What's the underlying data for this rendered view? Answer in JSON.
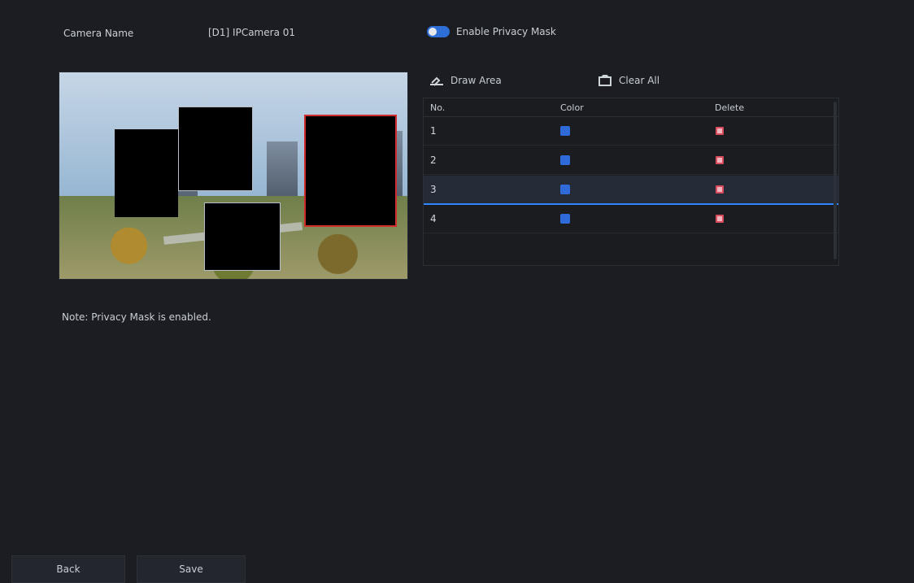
{
  "header": {
    "left_label": "Camera Name",
    "camera_value": "[D1] IPCamera 01",
    "mask_toggle_label": "Enable Privacy Mask"
  },
  "toolbar": {
    "draw_label": "Draw Area",
    "clear_label": "Clear All"
  },
  "table": {
    "headers": [
      "No.",
      "Color",
      "Delete"
    ],
    "rows": [
      {
        "no": "1",
        "color": "#2f6bd8",
        "delete_color": "#d84c5e"
      },
      {
        "no": "2",
        "color": "#2f6bd8",
        "delete_color": "#d84c5e"
      },
      {
        "no": "3",
        "color": "#2f6bd8",
        "delete_color": "#d84c5e"
      },
      {
        "no": "4",
        "color": "#2f6bd8",
        "delete_color": "#d84c5e"
      }
    ]
  },
  "info": {
    "text": "Note: Privacy Mask is enabled."
  },
  "buttons": {
    "back_label": "Back",
    "save_label": "Save"
  },
  "colors": {
    "accent": "#2f84ff",
    "danger": "#d12c2c"
  },
  "icons": {
    "draw": "draw-area-icon",
    "clear": "clear-icon"
  }
}
